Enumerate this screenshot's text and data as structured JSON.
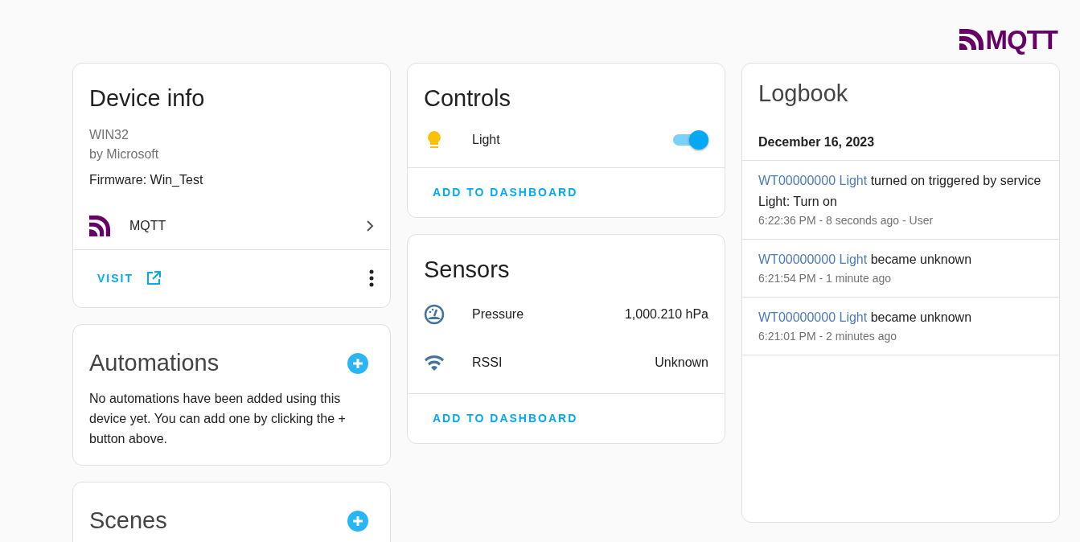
{
  "logo": {
    "text": "MQTT"
  },
  "device_info": {
    "title": "Device info",
    "model": "WIN32",
    "manufacturer": "by Microsoft",
    "firmware": "Firmware: Win_Test",
    "integration": "MQTT",
    "visit": "VISIT"
  },
  "automations": {
    "title": "Automations",
    "message": "No automations have been added using this device yet. You can add one by clicking the + button above."
  },
  "scenes": {
    "title": "Scenes"
  },
  "controls": {
    "title": "Controls",
    "items": [
      {
        "kind": "bulb",
        "name": "Light",
        "on": true
      }
    ],
    "action": "ADD TO DASHBOARD"
  },
  "sensors": {
    "title": "Sensors",
    "items": [
      {
        "kind": "gauge",
        "name": "Pressure",
        "value": "1,000.210 hPa"
      },
      {
        "kind": "wifi",
        "name": "RSSI",
        "value": "Unknown"
      }
    ],
    "action": "ADD TO DASHBOARD"
  },
  "logbook": {
    "title": "Logbook",
    "date": "December 16, 2023",
    "entries": [
      {
        "entity": "WT00000000 Light",
        "message": "turned on triggered by service Light: Turn on",
        "meta": "6:22:36 PM - 8 seconds ago - User"
      },
      {
        "entity": "WT00000000 Light",
        "message": "became unknown",
        "meta": "6:21:54 PM - 1 minute ago"
      },
      {
        "entity": "WT00000000 Light",
        "message": "became unknown",
        "meta": "6:21:01 PM - 2 minutes ago"
      }
    ]
  }
}
